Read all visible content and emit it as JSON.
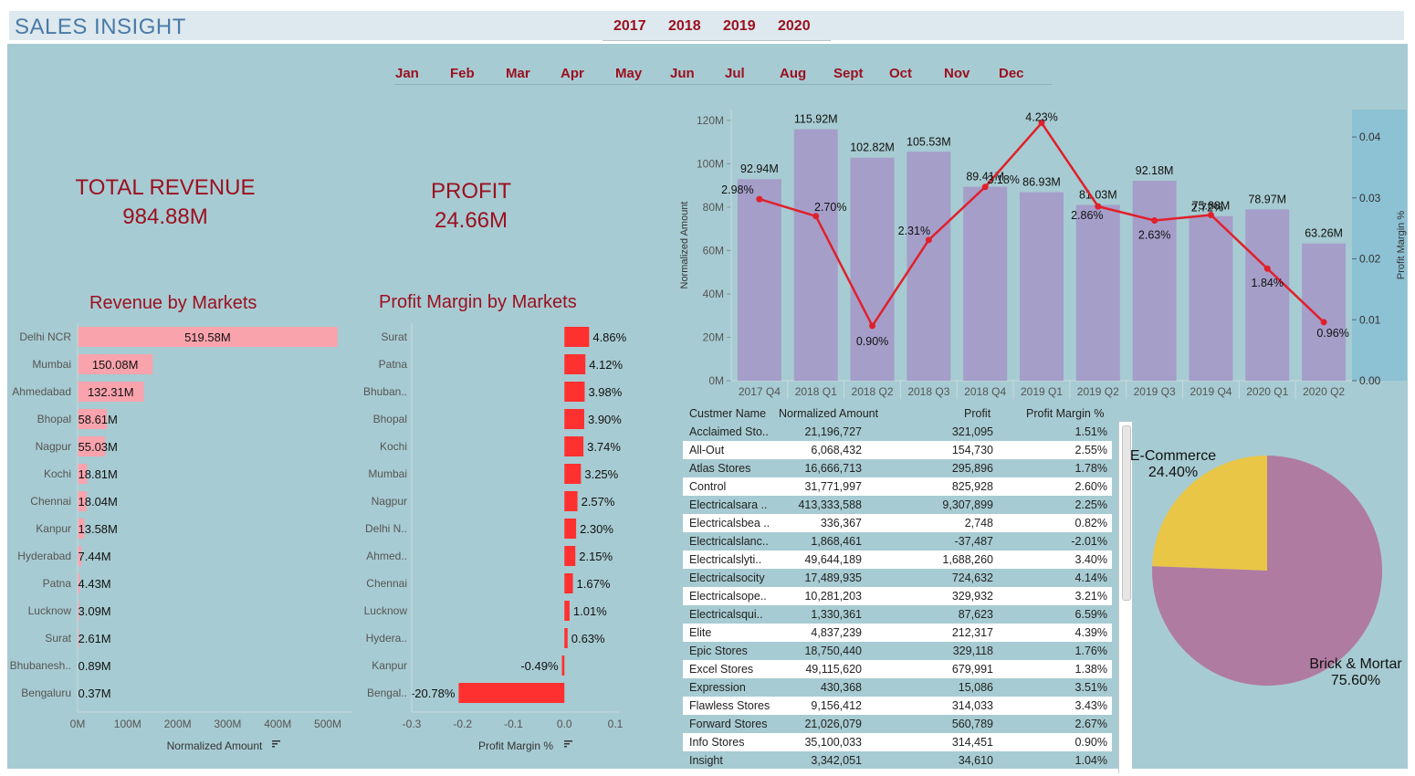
{
  "header": {
    "title": "SALES INSIGHT",
    "years": [
      "2017",
      "2018",
      "2019",
      "2020"
    ]
  },
  "months": [
    "Jan",
    "Feb",
    "Mar",
    "Apr",
    "May",
    "Jun",
    "Jul",
    "Aug",
    "Sept",
    "Oct",
    "Nov",
    "Dec"
  ],
  "kpi": {
    "revenue_label": "TOTAL REVENUE",
    "revenue_value": "984.88M",
    "profit_label": "PROFIT",
    "profit_value": "24.66M"
  },
  "colors": {
    "accent": "#9b1020",
    "background": "#a7cbd2",
    "revenue_bar": "#f9a3ad",
    "margin_bar": "#ff3030",
    "quarter_bar": "#a59ec9",
    "line": "#e0202a",
    "pie_ecom": "#e9c646",
    "pie_brick": "#b07ba1"
  },
  "chart_data": [
    {
      "type": "bar",
      "orientation": "horizontal",
      "title": "Revenue by Markets",
      "xlabel": "Normalized Amount",
      "categories": [
        "Delhi NCR",
        "Mumbai",
        "Ahmedabad",
        "Bhopal",
        "Nagpur",
        "Kochi",
        "Chennai",
        "Kanpur",
        "Hyderabad",
        "Patna",
        "Lucknow",
        "Surat",
        "Bhubanesh..",
        "Bengaluru"
      ],
      "values": [
        519.58,
        150.08,
        132.31,
        58.61,
        55.03,
        18.81,
        18.04,
        13.58,
        7.44,
        4.43,
        3.09,
        2.61,
        0.89,
        0.37
      ],
      "value_labels": [
        "519.58M",
        "150.08M",
        "132.31M",
        "58.61M",
        "55.03M",
        "18.81M",
        "18.04M",
        "13.58M",
        "7.44M",
        "4.43M",
        "3.09M",
        "2.61M",
        "0.89M",
        "0.37M"
      ],
      "xlim": [
        0,
        520
      ],
      "ticks": [
        0,
        100,
        200,
        300,
        400,
        500
      ],
      "tick_labels": [
        "0M",
        "100M",
        "200M",
        "300M",
        "400M",
        "500M"
      ]
    },
    {
      "type": "bar",
      "orientation": "horizontal",
      "title": "Profit Margin by Markets",
      "xlabel": "Profit Margin %",
      "categories": [
        "Surat",
        "Patna",
        "Bhuban..",
        "Bhopal",
        "Kochi",
        "Mumbai",
        "Nagpur",
        "Delhi N..",
        "Ahmed..",
        "Chennai",
        "Lucknow",
        "Hydera..",
        "Kanpur",
        "Bengal.."
      ],
      "values": [
        4.86,
        4.12,
        3.98,
        3.9,
        3.74,
        3.25,
        2.57,
        2.3,
        2.15,
        1.67,
        1.01,
        0.63,
        -0.49,
        -20.78
      ],
      "value_labels": [
        "4.86%",
        "4.12%",
        "3.98%",
        "3.90%",
        "3.74%",
        "3.25%",
        "2.57%",
        "2.30%",
        "2.15%",
        "1.67%",
        "1.01%",
        "0.63%",
        "-0.49%",
        "-20.78%"
      ],
      "xlim": [
        -0.3,
        0.1
      ],
      "ticks": [
        -0.3,
        -0.2,
        -0.1,
        0.0,
        0.1
      ],
      "tick_labels": [
        "-0.3",
        "-0.2",
        "-0.1",
        "0.0",
        "0.1"
      ]
    },
    {
      "type": "bar+line",
      "categories": [
        "2017 Q4",
        "2018 Q1",
        "2018 Q2",
        "2018 Q3",
        "2018 Q4",
        "2019 Q1",
        "2019 Q2",
        "2019 Q3",
        "2019 Q4",
        "2020 Q1",
        "2020 Q2"
      ],
      "series": [
        {
          "axis": "left",
          "type": "bar",
          "values": [
            92.94,
            115.92,
            102.82,
            105.53,
            89.41,
            86.93,
            81.03,
            92.18,
            75.88,
            78.97,
            63.26
          ],
          "labels": [
            "92.94M",
            "115.92M",
            "102.82M",
            "105.53M",
            "89.41M",
            "86.93M",
            "81.03M",
            "92.18M",
            "75.88M",
            "78.97M",
            "63.26M"
          ]
        },
        {
          "axis": "right",
          "type": "line",
          "values": [
            0.0298,
            0.027,
            0.009,
            0.0231,
            0.0318,
            0.0423,
            0.0286,
            0.0263,
            0.0272,
            0.0184,
            0.0096
          ],
          "labels": [
            "2.98%",
            "2.70%",
            "0.90%",
            "2.31%",
            "3.18%",
            "4.23%",
            "2.86%",
            "2.63%",
            "2.72%",
            "1.84%",
            "0.96%"
          ]
        }
      ],
      "ylabel": "Normalized Amount",
      "ylim": [
        0,
        125
      ],
      "yticks": [
        0,
        20,
        40,
        60,
        80,
        100,
        120
      ],
      "ytick_labels": [
        "0M",
        "20M",
        "40M",
        "60M",
        "80M",
        "100M",
        "120M"
      ],
      "y2label": "Profit Margin %",
      "y2lim": [
        0,
        0.0445
      ],
      "y2ticks": [
        0,
        0.01,
        0.02,
        0.03,
        0.04
      ],
      "y2tick_labels": [
        "0.00",
        "0.01",
        "0.02",
        "0.03",
        "0.04"
      ]
    },
    {
      "type": "table",
      "columns": [
        "Custmer Name",
        "Normalized Amount",
        "Profit",
        "Profit Margin %"
      ],
      "rows": [
        [
          "Acclaimed Sto..",
          "21,196,727",
          "321,095",
          "1.51%"
        ],
        [
          "All-Out",
          "6,068,432",
          "154,730",
          "2.55%"
        ],
        [
          "Atlas Stores",
          "16,666,713",
          "295,896",
          "1.78%"
        ],
        [
          "Control",
          "31,771,997",
          "825,928",
          "2.60%"
        ],
        [
          "Electricalsara ..",
          "413,333,588",
          "9,307,899",
          "2.25%"
        ],
        [
          "Electricalsbea ..",
          "336,367",
          "2,748",
          "0.82%"
        ],
        [
          "Electricalslanc..",
          "1,868,461",
          "-37,487",
          "-2.01%"
        ],
        [
          "Electricalslyti..",
          "49,644,189",
          "1,688,260",
          "3.40%"
        ],
        [
          "Electricalsocity",
          "17,489,935",
          "724,632",
          "4.14%"
        ],
        [
          "Electricalsope..",
          "10,281,203",
          "329,932",
          "3.21%"
        ],
        [
          "Electricalsqui..",
          "1,330,361",
          "87,623",
          "6.59%"
        ],
        [
          "Elite",
          "4,837,239",
          "212,317",
          "4.39%"
        ],
        [
          "Epic Stores",
          "18,750,440",
          "329,118",
          "1.76%"
        ],
        [
          "Excel Stores",
          "49,115,620",
          "679,991",
          "1.38%"
        ],
        [
          "Expression",
          "430,368",
          "15,086",
          "3.51%"
        ],
        [
          "Flawless Stores",
          "9,156,412",
          "314,033",
          "3.43%"
        ],
        [
          "Forward Stores",
          "21,026,079",
          "560,789",
          "2.67%"
        ],
        [
          "Info Stores",
          "35,100,033",
          "314,451",
          "0.90%"
        ],
        [
          "Insight",
          "3,342,051",
          "34,610",
          "1.04%"
        ]
      ]
    },
    {
      "type": "pie",
      "labels": [
        "E-Commerce",
        "Brick & Mortar"
      ],
      "values": [
        24.4,
        75.6
      ],
      "value_labels": [
        "24.40%",
        "75.60%"
      ]
    }
  ]
}
